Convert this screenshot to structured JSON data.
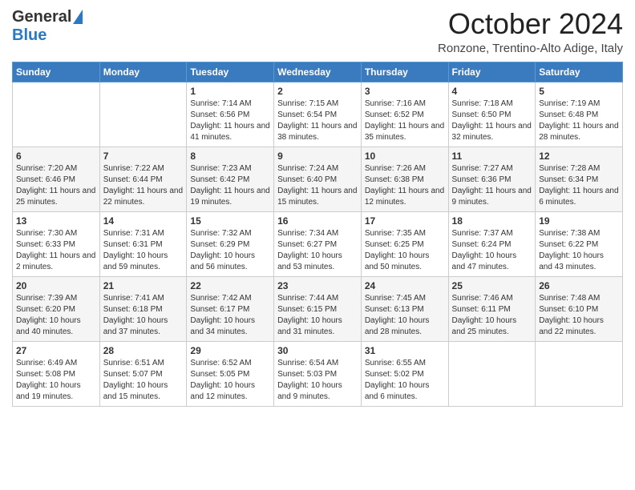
{
  "header": {
    "logo_general": "General",
    "logo_blue": "Blue",
    "month_title": "October 2024",
    "location": "Ronzone, Trentino-Alto Adige, Italy"
  },
  "days_of_week": [
    "Sunday",
    "Monday",
    "Tuesday",
    "Wednesday",
    "Thursday",
    "Friday",
    "Saturday"
  ],
  "weeks": [
    [
      {
        "day": "",
        "info": ""
      },
      {
        "day": "",
        "info": ""
      },
      {
        "day": "1",
        "info": "Sunrise: 7:14 AM\nSunset: 6:56 PM\nDaylight: 11 hours and 41 minutes."
      },
      {
        "day": "2",
        "info": "Sunrise: 7:15 AM\nSunset: 6:54 PM\nDaylight: 11 hours and 38 minutes."
      },
      {
        "day": "3",
        "info": "Sunrise: 7:16 AM\nSunset: 6:52 PM\nDaylight: 11 hours and 35 minutes."
      },
      {
        "day": "4",
        "info": "Sunrise: 7:18 AM\nSunset: 6:50 PM\nDaylight: 11 hours and 32 minutes."
      },
      {
        "day": "5",
        "info": "Sunrise: 7:19 AM\nSunset: 6:48 PM\nDaylight: 11 hours and 28 minutes."
      }
    ],
    [
      {
        "day": "6",
        "info": "Sunrise: 7:20 AM\nSunset: 6:46 PM\nDaylight: 11 hours and 25 minutes."
      },
      {
        "day": "7",
        "info": "Sunrise: 7:22 AM\nSunset: 6:44 PM\nDaylight: 11 hours and 22 minutes."
      },
      {
        "day": "8",
        "info": "Sunrise: 7:23 AM\nSunset: 6:42 PM\nDaylight: 11 hours and 19 minutes."
      },
      {
        "day": "9",
        "info": "Sunrise: 7:24 AM\nSunset: 6:40 PM\nDaylight: 11 hours and 15 minutes."
      },
      {
        "day": "10",
        "info": "Sunrise: 7:26 AM\nSunset: 6:38 PM\nDaylight: 11 hours and 12 minutes."
      },
      {
        "day": "11",
        "info": "Sunrise: 7:27 AM\nSunset: 6:36 PM\nDaylight: 11 hours and 9 minutes."
      },
      {
        "day": "12",
        "info": "Sunrise: 7:28 AM\nSunset: 6:34 PM\nDaylight: 11 hours and 6 minutes."
      }
    ],
    [
      {
        "day": "13",
        "info": "Sunrise: 7:30 AM\nSunset: 6:33 PM\nDaylight: 11 hours and 2 minutes."
      },
      {
        "day": "14",
        "info": "Sunrise: 7:31 AM\nSunset: 6:31 PM\nDaylight: 10 hours and 59 minutes."
      },
      {
        "day": "15",
        "info": "Sunrise: 7:32 AM\nSunset: 6:29 PM\nDaylight: 10 hours and 56 minutes."
      },
      {
        "day": "16",
        "info": "Sunrise: 7:34 AM\nSunset: 6:27 PM\nDaylight: 10 hours and 53 minutes."
      },
      {
        "day": "17",
        "info": "Sunrise: 7:35 AM\nSunset: 6:25 PM\nDaylight: 10 hours and 50 minutes."
      },
      {
        "day": "18",
        "info": "Sunrise: 7:37 AM\nSunset: 6:24 PM\nDaylight: 10 hours and 47 minutes."
      },
      {
        "day": "19",
        "info": "Sunrise: 7:38 AM\nSunset: 6:22 PM\nDaylight: 10 hours and 43 minutes."
      }
    ],
    [
      {
        "day": "20",
        "info": "Sunrise: 7:39 AM\nSunset: 6:20 PM\nDaylight: 10 hours and 40 minutes."
      },
      {
        "day": "21",
        "info": "Sunrise: 7:41 AM\nSunset: 6:18 PM\nDaylight: 10 hours and 37 minutes."
      },
      {
        "day": "22",
        "info": "Sunrise: 7:42 AM\nSunset: 6:17 PM\nDaylight: 10 hours and 34 minutes."
      },
      {
        "day": "23",
        "info": "Sunrise: 7:44 AM\nSunset: 6:15 PM\nDaylight: 10 hours and 31 minutes."
      },
      {
        "day": "24",
        "info": "Sunrise: 7:45 AM\nSunset: 6:13 PM\nDaylight: 10 hours and 28 minutes."
      },
      {
        "day": "25",
        "info": "Sunrise: 7:46 AM\nSunset: 6:11 PM\nDaylight: 10 hours and 25 minutes."
      },
      {
        "day": "26",
        "info": "Sunrise: 7:48 AM\nSunset: 6:10 PM\nDaylight: 10 hours and 22 minutes."
      }
    ],
    [
      {
        "day": "27",
        "info": "Sunrise: 6:49 AM\nSunset: 5:08 PM\nDaylight: 10 hours and 19 minutes."
      },
      {
        "day": "28",
        "info": "Sunrise: 6:51 AM\nSunset: 5:07 PM\nDaylight: 10 hours and 15 minutes."
      },
      {
        "day": "29",
        "info": "Sunrise: 6:52 AM\nSunset: 5:05 PM\nDaylight: 10 hours and 12 minutes."
      },
      {
        "day": "30",
        "info": "Sunrise: 6:54 AM\nSunset: 5:03 PM\nDaylight: 10 hours and 9 minutes."
      },
      {
        "day": "31",
        "info": "Sunrise: 6:55 AM\nSunset: 5:02 PM\nDaylight: 10 hours and 6 minutes."
      },
      {
        "day": "",
        "info": ""
      },
      {
        "day": "",
        "info": ""
      }
    ]
  ]
}
